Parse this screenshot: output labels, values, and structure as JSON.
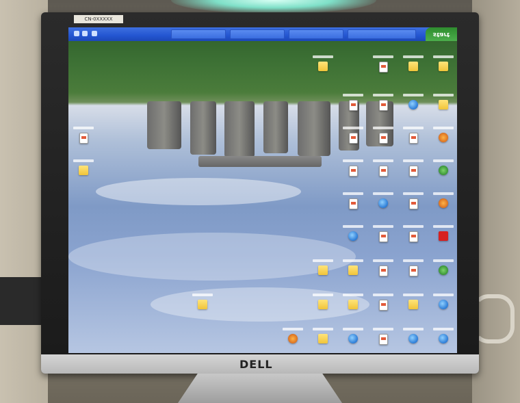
{
  "monitor": {
    "brand": "DELL",
    "service_tag": "CN-0XXXXX"
  },
  "taskbar": {
    "start_label": "start"
  },
  "desktop": {
    "orientation": "upside-down",
    "wallpaper": "Stonehenge (inverted)",
    "icon_count": 45
  },
  "colors": {
    "taskbar_blue": "#2456d1",
    "start_green": "#2e8c2e",
    "bezel": "#1a1a1a",
    "sky": "#8aa3cf",
    "grass": "#3c7034"
  }
}
